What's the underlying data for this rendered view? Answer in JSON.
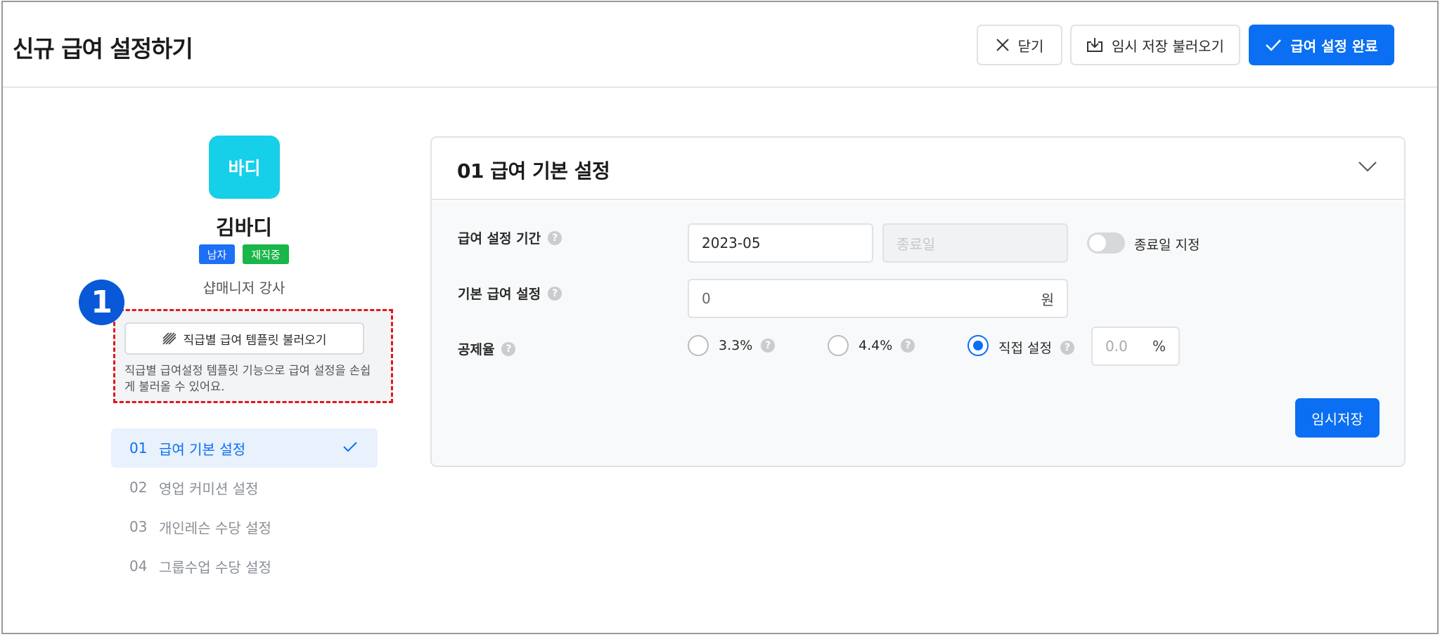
{
  "header": {
    "title": "신규 급여 설정하기",
    "close_label": "닫기",
    "load_draft_label": "임시 저장 불러오기",
    "complete_label": "급여 설정 완료",
    "accent_color": "#0a6ff2"
  },
  "employee": {
    "avatar_text": "바디",
    "name": "김바디",
    "gender_badge": "남자",
    "status_badge": "재직중",
    "role": "샵매니저  강사"
  },
  "callout_number": "1",
  "template": {
    "button_label": "직급별 급여 템플릿 불러오기",
    "description": "직급별 급여설정 템플릿 기능으로 급여 설정을 손쉽게 불러올 수 있어요."
  },
  "steps": [
    {
      "num": "01",
      "label": "급여 기본 설정",
      "active": true
    },
    {
      "num": "02",
      "label": "영업 커미션 설정",
      "active": false
    },
    {
      "num": "03",
      "label": "개인레슨 수당 설정",
      "active": false
    },
    {
      "num": "04",
      "label": "그룹수업 수당 설정",
      "active": false
    }
  ],
  "panel": {
    "title": "01  급여 기본 설정",
    "period": {
      "label": "급여 설정 기간",
      "start_value": "2023-05",
      "end_placeholder": "종료일",
      "toggle_label": "종료일 지정",
      "toggle_on": false
    },
    "base_pay": {
      "label": "기본 급여 설정",
      "value": "0",
      "unit": "원"
    },
    "deduction": {
      "label": "공제율",
      "options": [
        {
          "label": "3.3%",
          "checked": false
        },
        {
          "label": "4.4%",
          "checked": false
        },
        {
          "label": "직접 설정",
          "checked": true
        }
      ],
      "custom_placeholder": "0.0",
      "custom_unit": "%"
    },
    "save_label": "임시저장"
  }
}
